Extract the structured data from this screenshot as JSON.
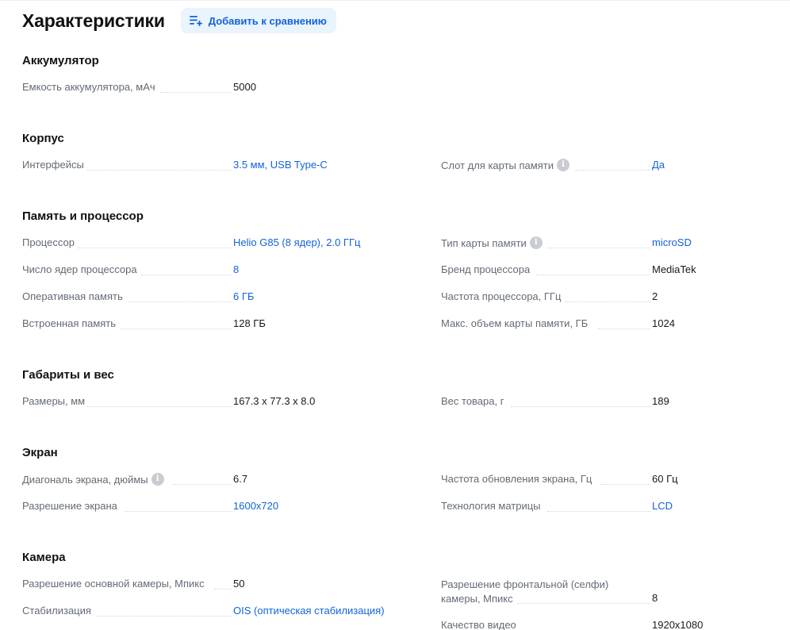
{
  "header": {
    "title": "Характеристики",
    "compare_label": "Добавить к сравнению",
    "compare_icon": "list-add-icon"
  },
  "colors": {
    "link": "#1463d8",
    "label": "#636b75",
    "button_bg": "#eaf4fd"
  },
  "sections": {
    "battery": {
      "title": "Аккумулятор",
      "capacity_label": "Емкость аккумулятора, мАч",
      "capacity_value": "5000"
    },
    "body": {
      "title": "Корпус",
      "interfaces_label": "Интерфейсы",
      "interfaces_value": "3.5 мм, USB Type-C",
      "card_slot_label": "Слот для карты памяти",
      "card_slot_value": "Да"
    },
    "memory": {
      "title": "Память и процессор",
      "cpu_label": "Процессор",
      "cpu_value": "Helio G85 (8 ядер), 2.0 ГГц",
      "cores_label": "Число ядер процессора",
      "cores_value": "8",
      "ram_label": "Оперативная память",
      "ram_value": "6 ГБ",
      "storage_label": "Встроенная память",
      "storage_value": "128 ГБ",
      "card_type_label": "Тип карты памяти",
      "card_type_value": "microSD",
      "brand_label": "Бренд процессора",
      "brand_value": "MediaTek",
      "freq_label": "Частота процессора, ГГц",
      "freq_value": "2",
      "max_card_label": "Макс. объем карты памяти, ГБ",
      "max_card_value": "1024"
    },
    "dimensions": {
      "title": "Габариты и вес",
      "size_label": "Размеры, мм",
      "size_value": "167.3 x 77.3 x 8.0",
      "weight_label": "Вес товара, г",
      "weight_value": "189"
    },
    "screen": {
      "title": "Экран",
      "diag_label": "Диагональ экрана, дюймы",
      "diag_value": "6.7",
      "res_label": "Разрешение экрана",
      "res_value": "1600x720",
      "refresh_label": "Частота обновления экрана, Гц",
      "refresh_value": "60 Гц",
      "tech_label": "Технология матрицы",
      "tech_value": "LCD"
    },
    "camera": {
      "title": "Камера",
      "main_res_label": "Разрешение основной камеры, Мпикс",
      "main_res_value": "50",
      "stab_label": "Стабилизация",
      "stab_value": "OIS (оптическая стабилизация)",
      "front_label_line1": "Разрешение фронтальной (селфи)",
      "front_label_line2": "камеры, Мпикс",
      "front_value": "8",
      "video_label": "Качество видео",
      "video_value": "1920x1080"
    }
  }
}
